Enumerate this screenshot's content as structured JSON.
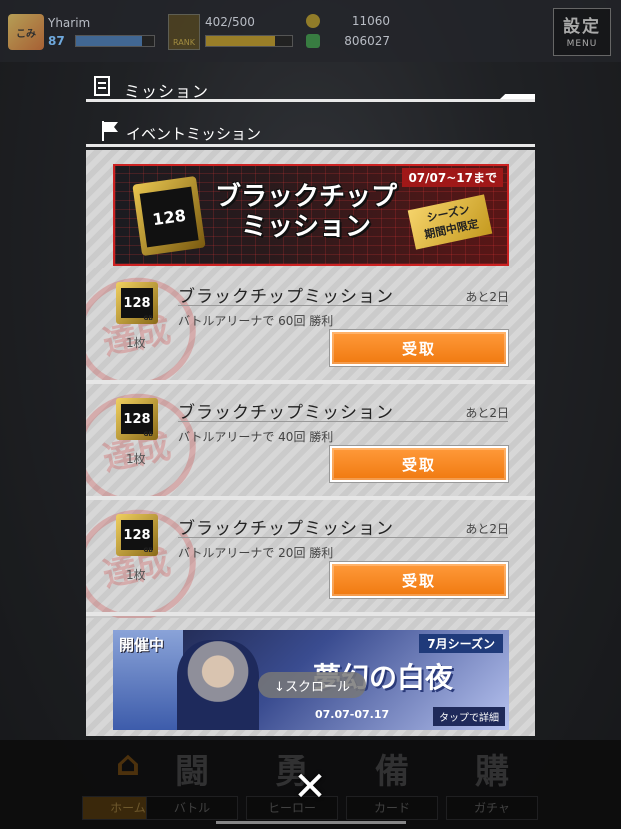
{
  "player": {
    "avatar_text": "こみ",
    "name": "Yharim",
    "level": "87",
    "exp_fraction": 0.85
  },
  "stamina": {
    "rank_label": "RANK",
    "text": "402/500",
    "fraction": 0.8
  },
  "currency": {
    "coins": "11060",
    "gems": "806027"
  },
  "settings": {
    "label": "設定",
    "sub": "MENU"
  },
  "dialog": {
    "title": "ミッション",
    "section_title": "イベントミッション"
  },
  "event_banner": {
    "date": "07/07~17まで",
    "chip_text": "128",
    "title_line1": "ブラックチップ",
    "title_line2": "ミッション",
    "tag_line1": "シーズン",
    "tag_line2": "期間中限定"
  },
  "missions": [
    {
      "chip_text": "128",
      "chip_gb": "GB",
      "qty": "1枚",
      "stamp": "達成",
      "title": "ブラックチップミッション",
      "remaining": "あと2日",
      "description": "バトルアリーナで 60回 勝利",
      "button": "受取"
    },
    {
      "chip_text": "128",
      "chip_gb": "GB",
      "qty": "1枚",
      "stamp": "達成",
      "title": "ブラックチップミッション",
      "remaining": "あと2日",
      "description": "バトルアリーナで 40回 勝利",
      "button": "受取"
    },
    {
      "chip_text": "128",
      "chip_gb": "GB",
      "qty": "1枚",
      "stamp": "達成",
      "title": "ブラックチップミッション",
      "remaining": "あと2日",
      "description": "バトルアリーナで 20回 勝利",
      "button": "受取"
    }
  ],
  "promo_banner": {
    "live_label": "開催中",
    "season": "7月シーズン",
    "title": "夢幻の白夜",
    "dates": "07.07-07.17",
    "detail": "タップで詳細"
  },
  "scroll_hint": "↓スクロール",
  "bottom_nav": [
    {
      "glyph": "⌂",
      "label": "ホーム",
      "active": true
    },
    {
      "glyph": "闘",
      "label": "バトル",
      "active": false
    },
    {
      "glyph": "勇",
      "label": "ヒーロー",
      "active": false
    },
    {
      "glyph": "備",
      "label": "カード",
      "active": false
    },
    {
      "glyph": "購",
      "label": "ガチャ",
      "active": false
    }
  ],
  "close_glyph": "✕"
}
